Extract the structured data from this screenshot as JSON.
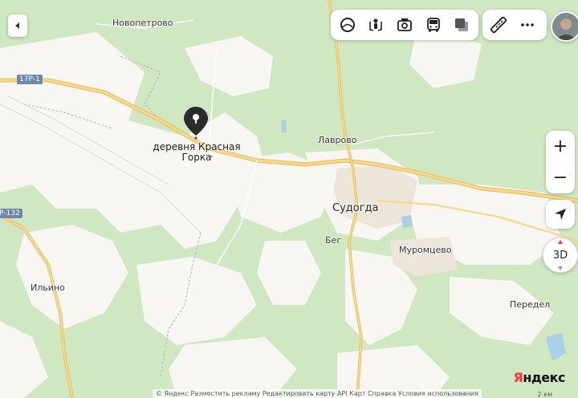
{
  "map": {
    "places": [
      {
        "name": "Новопетрово"
      },
      {
        "name": "Лаврово"
      },
      {
        "name": "Судогда"
      },
      {
        "name": "Бег"
      },
      {
        "name": "Муромцево"
      },
      {
        "name": "Ильино"
      },
      {
        "name": "Передел"
      }
    ],
    "roads": [
      {
        "ref": "17Р-1"
      },
      {
        "ref": "Р-132"
      }
    ],
    "pin": {
      "label_line1": "деревня Красная",
      "label_line2": "Горка"
    }
  },
  "controls": {
    "collapse_icon": "chevron-left-icon",
    "toolbar": [
      {
        "icon": "layers-icon"
      },
      {
        "icon": "panorama-icon"
      },
      {
        "icon": "camera-icon"
      },
      {
        "icon": "bus-icon"
      },
      {
        "icon": "traffic-layer-icon"
      }
    ],
    "ruler_icon": "ruler-icon",
    "more_icon": "more-icon",
    "zoom_in": "+",
    "zoom_out": "−",
    "locate_icon": "navigation-arrow-icon",
    "mode_3d": "3D"
  },
  "footer": {
    "copyright": "© Яндекс  Разместить рекламу  Редактировать карту  API Карт  Справка  Условия использования",
    "scale": "2 км",
    "brand_first": "Я",
    "brand_rest": "ндекс"
  },
  "colors": {
    "forest": "#cfe8c2",
    "open": "#f7f6f2",
    "road": "#f2d58a",
    "water": "#a9d0e8",
    "pin": "#2b2b2b",
    "brand_red": "#ff3333"
  }
}
